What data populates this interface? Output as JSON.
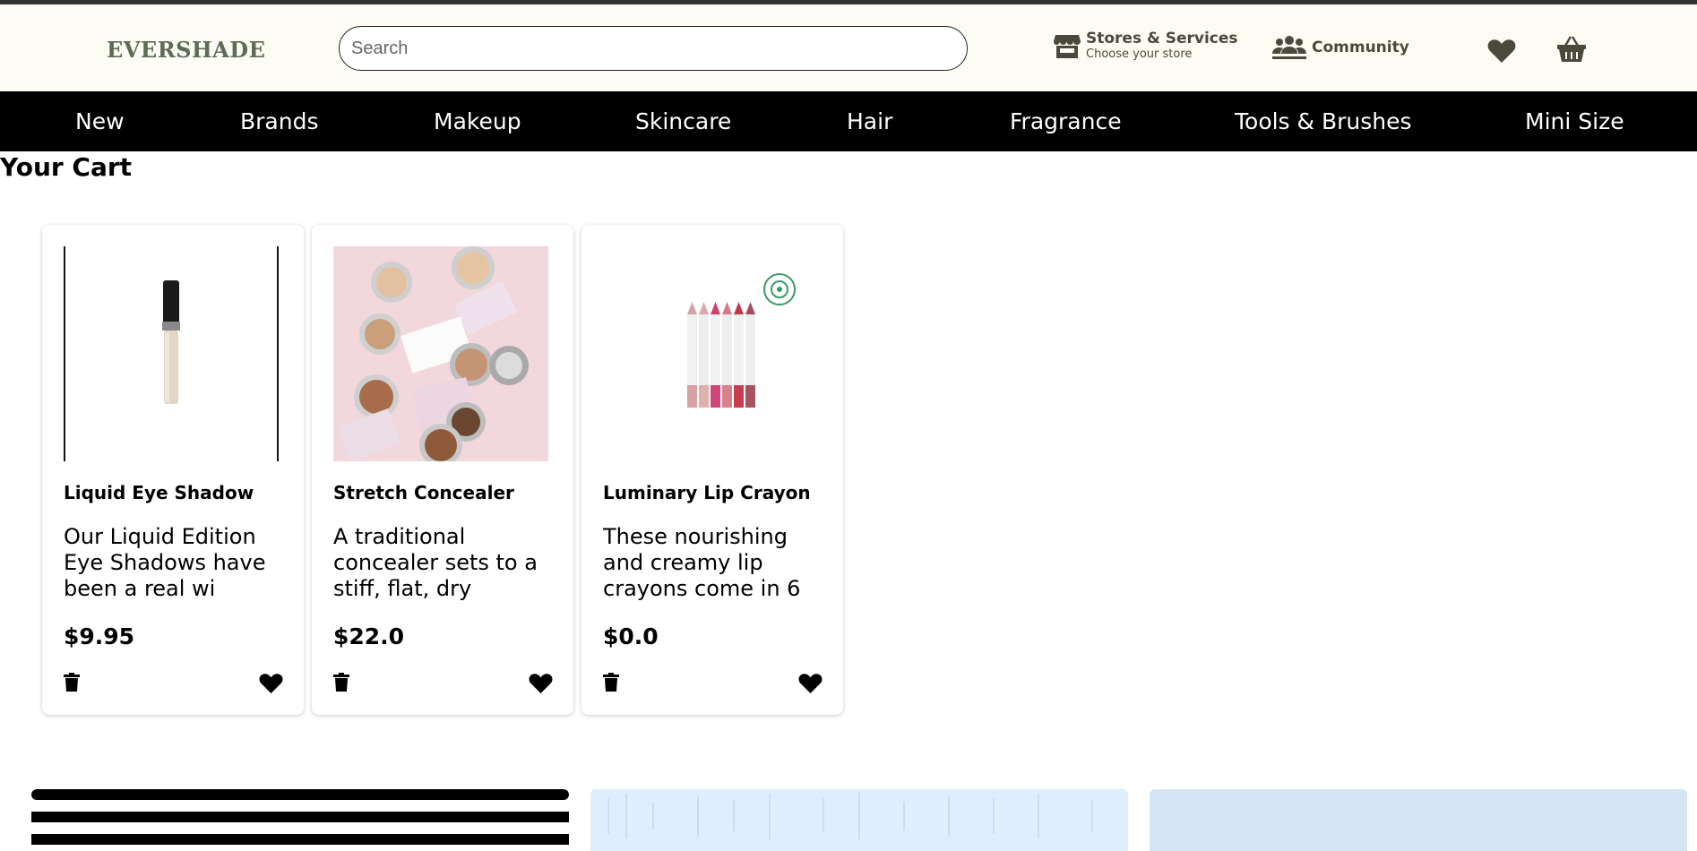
{
  "header": {
    "logo": "EVERSHADE",
    "search_placeholder": "Search",
    "stores": {
      "title": "Stores & Services",
      "subtitle": "Choose your store",
      "icon": "store-icon"
    },
    "community": {
      "label": "Community",
      "icon": "community-icon"
    },
    "favorites_icon": "heart-icon",
    "basket_icon": "basket-icon"
  },
  "nav": {
    "items": [
      "New",
      "Brands",
      "Makeup",
      "Skincare",
      "Hair",
      "Fragrance",
      "Tools & Brushes",
      "Mini Size"
    ]
  },
  "cart": {
    "title": "Your Cart",
    "items": [
      {
        "name": "Liquid Eye Shadow",
        "desc": "Our Liquid Edition Eye Shadows have been a real wi",
        "price": "$9.95",
        "image": "concealer-tube"
      },
      {
        "name": "Stretch Concealer",
        "desc": "A traditional concealer sets to a stiff, flat, dry",
        "price": "$22.0",
        "image": "concealer-compacts"
      },
      {
        "name": "Luminary Lip Crayon",
        "desc": "These nourishing and creamy lip crayons come in 6",
        "price": "$0.0",
        "image": "lip-crayons"
      }
    ]
  },
  "colors": {
    "header_bg": "#fcfcf5",
    "logo": "#5e6b55",
    "header_text": "#4a4a3c",
    "nav_bg": "#000000",
    "nav_text": "#ffffff"
  }
}
